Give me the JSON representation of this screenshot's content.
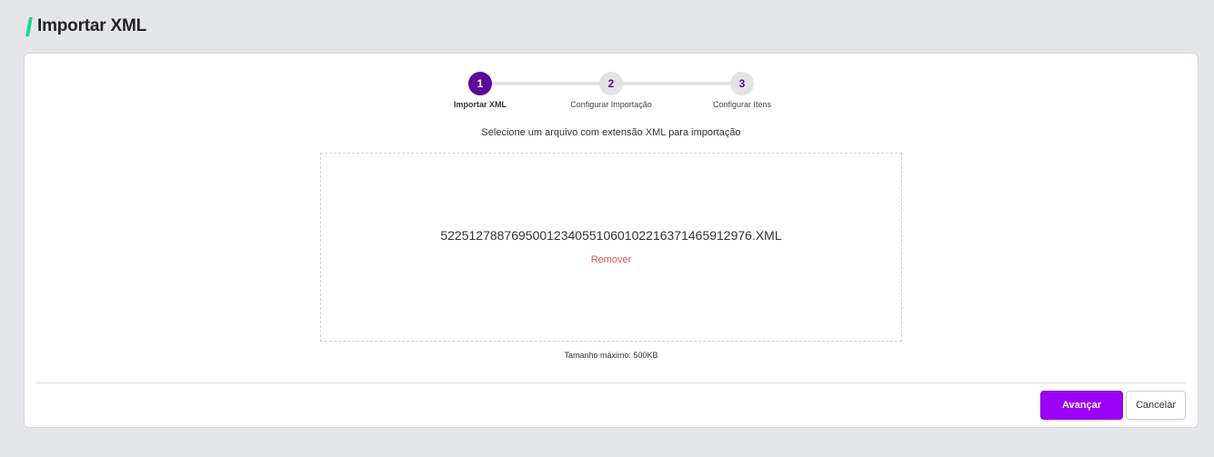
{
  "page": {
    "title": "Importar XML"
  },
  "stepper": {
    "steps": [
      {
        "number": "1",
        "label": "Importar XML",
        "state": "active"
      },
      {
        "number": "2",
        "label": "Configurar Importação",
        "state": "inactive"
      },
      {
        "number": "3",
        "label": "Configurar Itens",
        "state": "inactive"
      }
    ]
  },
  "upload": {
    "instructions": "Selecione um arquivo com extensão XML para importação",
    "file_name": "52251278876950012340551060102216371465912976.XML",
    "remove_label": "Remover",
    "max_size": "Tamanho máximo: 500KB"
  },
  "actions": {
    "next_label": "Avançar",
    "cancel_label": "Cancelar"
  },
  "colors": {
    "accent": "#1ed98a",
    "step_active": "#5b0a99",
    "primary_button": "#9b00f7",
    "remove_link": "#e05252"
  }
}
